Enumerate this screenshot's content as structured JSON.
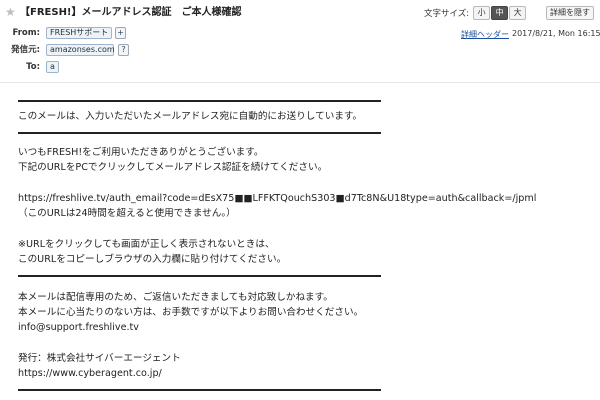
{
  "header": {
    "star": "★",
    "subject": "【FRESH!】メールアドレス認証　ご本人様確認",
    "font_size_label": "文字サイズ:",
    "font_size_options": [
      "小",
      "中",
      "大"
    ],
    "font_size_selected": "中",
    "hide_details_label": "詳細を隠す",
    "from_label": "From:",
    "from_value": "FRESHサポート",
    "add_contact": "+",
    "sender_label": "発信元:",
    "sender_value": "amazonses.com",
    "sender_help": "?",
    "to_label": "To:",
    "to_value": "a",
    "detail_header_link": "詳細ヘッダー",
    "date": "2017/8/21, Mon 16:15"
  },
  "body": {
    "lines": [
      "このメールは、入力いただいたメールアドレス宛に自動的にお送りしています。",
      "いつもFRESH!をご利用いただきありがとうございます。",
      "下記のURLをPCでクリックしてメールアドレス認証を続けてください。",
      "https://freshlive.tv/auth_email?code=dEsX75■■LFFKTQouchS303■d7Tc8N&U18type=auth&callback=/jpml",
      "（このURLは24時間を超えると使用できません。）",
      "※URLをクリックしても画面が正しく表示されないときは、",
      "このURLをコピーしブラウザの入力欄に貼り付けてください。",
      "本メールは配信専用のため、ご返信いただきましても対応致しかねます。",
      "本メールに心当たりのない方は、お手数ですが以下よりお問い合わせください。",
      "info@support.freshlive.tv",
      "発行：株式会社サイバーエージェント",
      "https://www.cyberagent.co.jp/"
    ]
  }
}
